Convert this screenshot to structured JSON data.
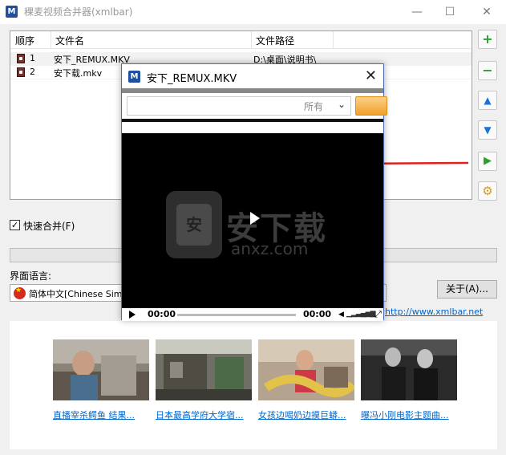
{
  "window": {
    "title": "稞麦视频合并器(xmlbar)",
    "app_icon": "M",
    "buttons": [
      "minimize-icon",
      "maximize-icon",
      "close-icon"
    ]
  },
  "table": {
    "headers": [
      "顺序",
      "文件名",
      "文件路径"
    ],
    "rows": [
      {
        "order": "1",
        "name": "安下_REMUX.MKV",
        "path": "D:\\桌面\\说明书\\"
      },
      {
        "order": "2",
        "name": "安下载.mkv",
        "path": ""
      }
    ]
  },
  "side_buttons": [
    {
      "icon": "add-icon",
      "glyph": "+"
    },
    {
      "icon": "remove-icon",
      "glyph": "−"
    },
    {
      "icon": "move-up-icon",
      "glyph": "▲"
    },
    {
      "icon": "move-down-icon",
      "glyph": "▼"
    },
    {
      "icon": "play-icon",
      "glyph": "▶"
    },
    {
      "icon": "settings-icon",
      "glyph": "⚙"
    }
  ],
  "options": {
    "fast_merge_label": "快速合并(F)",
    "fast_merge_checked": true,
    "check_glyph": "✓"
  },
  "language": {
    "label": "界面语言:",
    "selected": "简体中文[Chinese Simpl"
  },
  "about_button": "关于(A)...",
  "website": "http://www.xmlbar.net",
  "thumbnails": [
    {
      "caption": "直播宰杀鳄鱼 结果..."
    },
    {
      "caption": "日本最高学府大学宿..."
    },
    {
      "caption": "女孩边喝奶边摸巨蟒..."
    },
    {
      "caption": "曝冯小刚电影主题曲..."
    }
  ],
  "player": {
    "title": "安下_REMUX.MKV",
    "filter_label": "所有",
    "time_current": "00:00",
    "time_total": "00:00",
    "watermark_cn": "安下载",
    "watermark_en": "anxz.com",
    "logo_text": "安",
    "close_glyph": "✕",
    "chevron_glyph": "⌄",
    "volume_glyph": "◀",
    "volume_bars": "▁▂▃▄▅▆",
    "fullscreen_glyph": "⤢"
  },
  "colors": {
    "accent": "#0066cc",
    "arrow": "#e0201a",
    "add": "#2aa12a",
    "remove": "#2aa12a",
    "move": "#1a73d9",
    "play": "#2aa12a",
    "settings": "#d89a1a"
  }
}
